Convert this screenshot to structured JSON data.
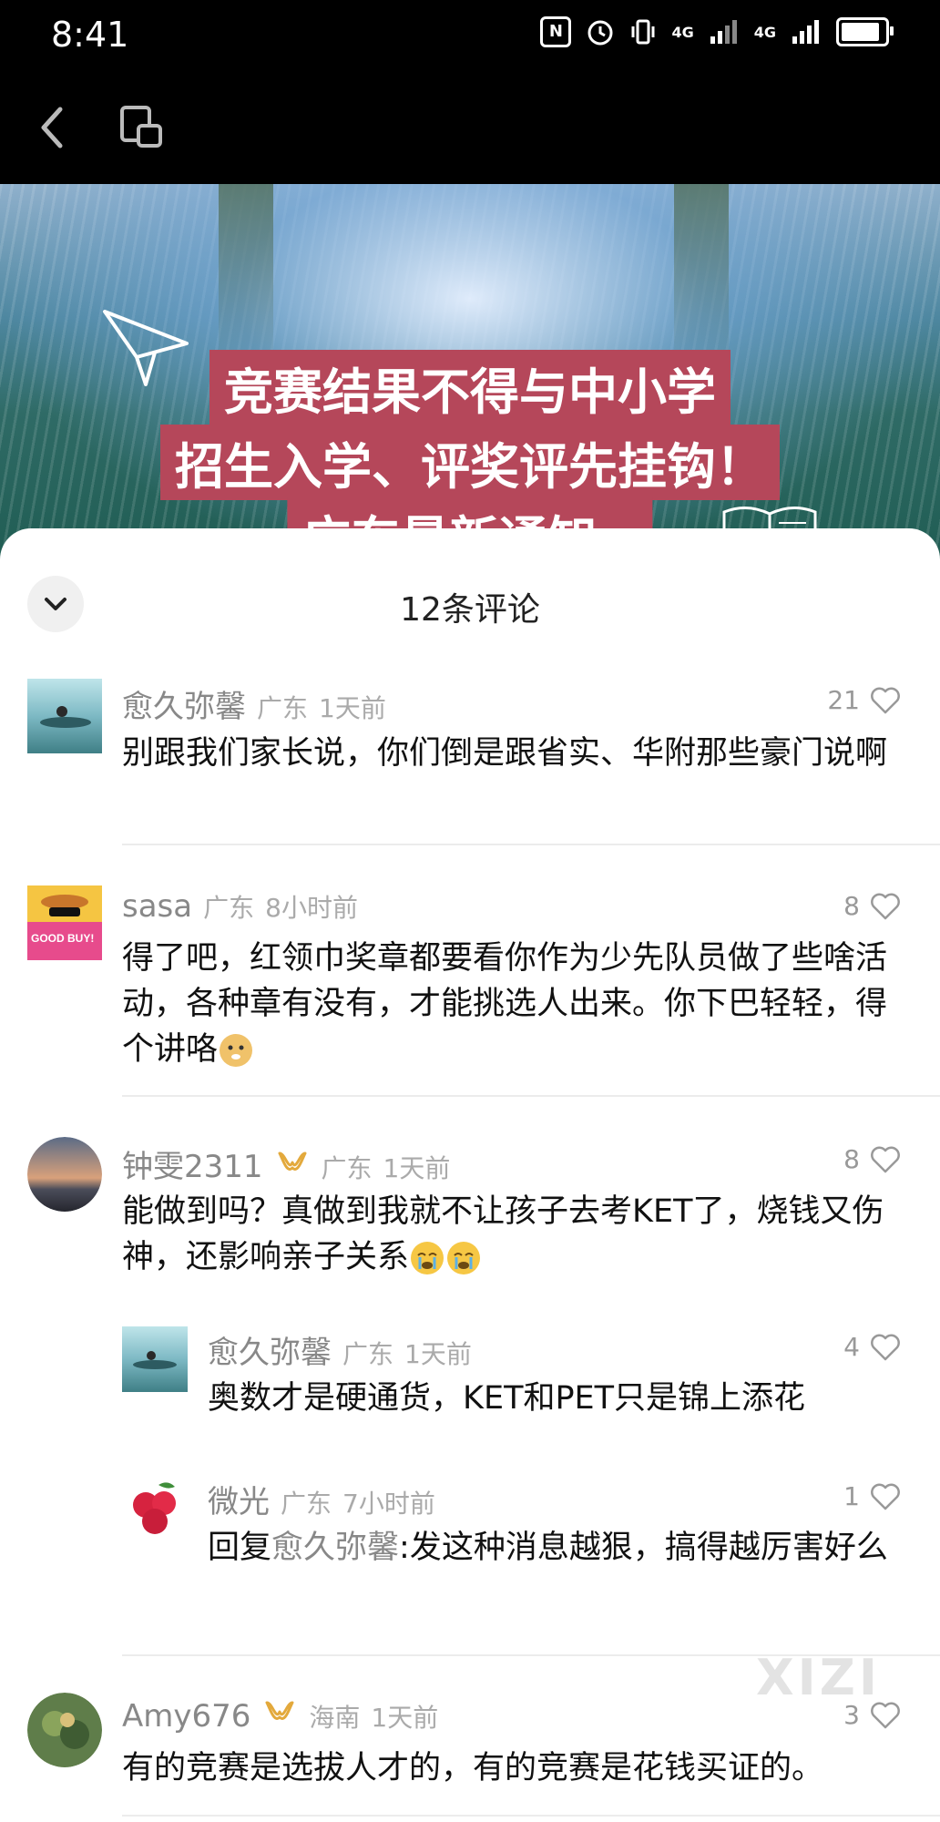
{
  "status": {
    "time": "8:41",
    "net1": "4G",
    "net2": "4G",
    "battery_level": 0.9
  },
  "banner": {
    "line1": "竞赛结果不得与中小学",
    "line2": "招生入学、评奖评先挂钩！",
    "line3": "广东最新通知→"
  },
  "sheet": {
    "title": "12条评论"
  },
  "comments": [
    {
      "user": "愈久弥馨",
      "loc": "广东",
      "time": "1天前",
      "likes": "21",
      "text": "别跟我们家长说，你们倒是跟省实、华附那些豪门说啊"
    },
    {
      "user": "sasa",
      "loc": "广东",
      "time": "8小时前",
      "likes": "8",
      "text": "得了吧，红领巾奖章都要看你作为少先队员做了些啥活动，各种章有没有，才能挑选人出来。你下巴轻轻，得个讲咯"
    },
    {
      "user": "钟雯2311",
      "loc": "广东",
      "time": "1天前",
      "likes": "8",
      "text": "能做到吗？真做到我就不让孩子去考KET了，烧钱又伤神，还影响亲子关系"
    },
    {
      "user": "Amy676",
      "loc": "海南",
      "time": "1天前",
      "likes": "3",
      "text": "有的竞赛是选拔人才的，有的竞赛是花钱买证的。"
    }
  ],
  "replies": [
    {
      "user": "愈久弥馨",
      "loc": "广东",
      "time": "1天前",
      "likes": "4",
      "text": "奥数才是硬通货，KET和PET只是锦上添花"
    },
    {
      "user": "微光",
      "loc": "广东",
      "time": "7小时前",
      "likes": "1",
      "reply_prefix": "回复",
      "reply_to": "愈久弥馨",
      "text": ":发这种消息越狠，搞得越厉害好么"
    }
  ],
  "avatar_sasa_text": "GOOD BUY!",
  "watermark": "XIZI"
}
